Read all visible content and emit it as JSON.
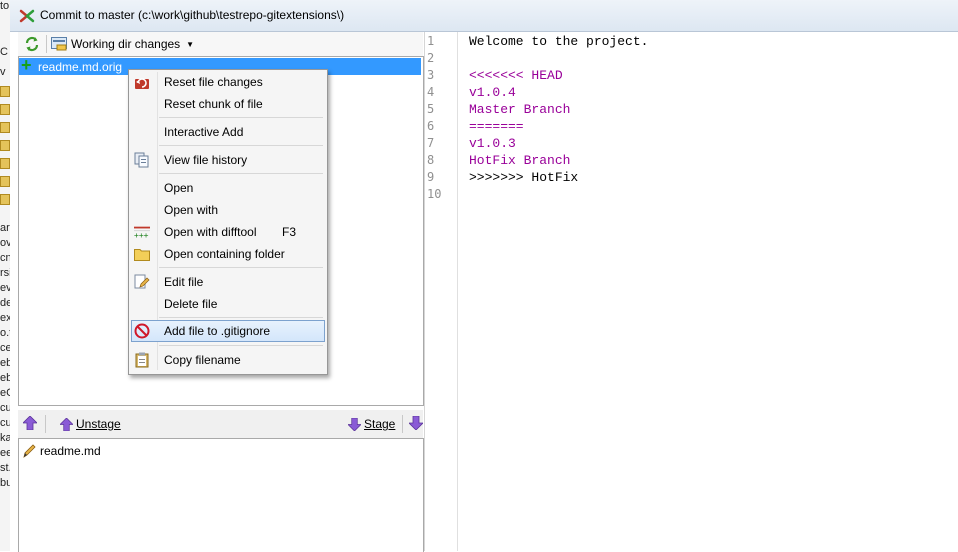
{
  "window": {
    "title": "Commit to master (c:\\work\\github\\testrepo-gitextensions\\)"
  },
  "behind_glyphs": [
    "to",
    "C",
    "v",
    "",
    "",
    "",
    "",
    "",
    "",
    "",
    "ar",
    "ov",
    "cn",
    "rsi",
    "ev",
    "de",
    "ex",
    "o.t",
    "ces",
    "eb",
    "eb",
    "eC",
    "cu",
    "cu",
    "ka.",
    "ee",
    "st.",
    "bu"
  ],
  "toolbar": {
    "working_dir_label": "Working dir changes"
  },
  "unstaged": {
    "files": [
      "readme.md.orig"
    ]
  },
  "context_menu": {
    "items": [
      {
        "label": "Reset file changes",
        "icon": "reset-icon"
      },
      {
        "label": "Reset chunk of file",
        "icon": ""
      },
      {
        "label": "Interactive Add",
        "icon": ""
      },
      {
        "label": "View file history",
        "icon": "history-icon"
      },
      {
        "label": "Open",
        "icon": ""
      },
      {
        "label": "Open with",
        "icon": ""
      },
      {
        "label": "Open with difftool",
        "shortcut": "F3",
        "icon": "difftool-icon"
      },
      {
        "label": "Open containing folder",
        "icon": "folder-icon"
      },
      {
        "label": "Edit file",
        "icon": "edit-icon"
      },
      {
        "label": "Delete file",
        "icon": ""
      },
      {
        "label": "Add file to .gitignore",
        "icon": "no-entry-icon",
        "highlighted": true
      },
      {
        "label": "Copy filename",
        "icon": "clipboard-icon"
      }
    ]
  },
  "stage_bar": {
    "unstage_label": "Unstage",
    "stage_label": "Stage"
  },
  "staged": {
    "files": [
      "readme.md"
    ]
  },
  "diff": {
    "lines": [
      {
        "n": "1",
        "text": "Welcome to the project.",
        "color": "#000000"
      },
      {
        "n": "2",
        "text": "",
        "color": "#000000"
      },
      {
        "n": "3",
        "text": "<<<<<<< HEAD",
        "color": "#990099"
      },
      {
        "n": "4",
        "text": "v1.0.4",
        "color": "#990099"
      },
      {
        "n": "5",
        "text": "Master Branch",
        "color": "#990099"
      },
      {
        "n": "6",
        "text": "=======",
        "color": "#990099"
      },
      {
        "n": "7",
        "text": "v1.0.3",
        "color": "#990099"
      },
      {
        "n": "8",
        "text": "HotFix Branch",
        "color": "#990099"
      },
      {
        "n": "9",
        "text": ">>>>>>> HotFix",
        "color": "#000000"
      },
      {
        "n": "10",
        "text": "",
        "color": "#000000"
      }
    ]
  },
  "colors": {
    "selection": "#3399ff",
    "conflict_marker": "#990099",
    "add_plus": "#18a018"
  }
}
